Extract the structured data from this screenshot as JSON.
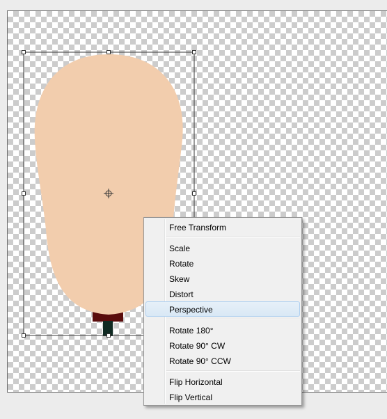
{
  "menu": {
    "group1": [
      {
        "label": "Free Transform"
      }
    ],
    "group2": [
      {
        "label": "Scale"
      },
      {
        "label": "Rotate"
      },
      {
        "label": "Skew"
      },
      {
        "label": "Distort"
      },
      {
        "label": "Perspective",
        "highlighted": true
      }
    ],
    "group3": [
      {
        "label": "Rotate 180°"
      },
      {
        "label": "Rotate 90° CW"
      },
      {
        "label": "Rotate 90° CCW"
      }
    ],
    "group4": [
      {
        "label": "Flip Horizontal"
      },
      {
        "label": "Flip Vertical"
      }
    ]
  },
  "colors": {
    "skin": "#f2cdad",
    "base": "#5a0c0c",
    "stem": "#0f2a22",
    "menu_bg": "#f0f0f0",
    "highlight": "#d9e8f5"
  },
  "icons": {
    "reference_point": "crosshair-icon"
  }
}
